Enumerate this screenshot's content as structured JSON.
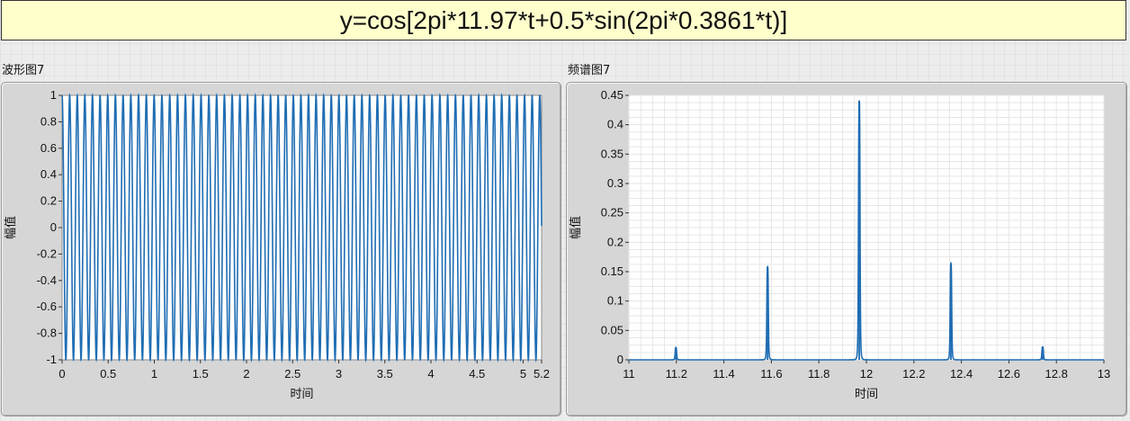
{
  "formula": "y=cos[2pi*11.97*t+0.5*sin(2pi*0.3861*t)]",
  "panels": {
    "left_title": "波形图7",
    "right_title": "频谱图7"
  },
  "colors": {
    "trace": "#1f6db3",
    "plot_bg": "#ffffff",
    "panel_bg": "#d6d6d6",
    "grid": "#e6e6e6"
  },
  "chart_data": [
    {
      "type": "line",
      "title": "波形图7",
      "xlabel": "时间",
      "ylabel": "幅值",
      "xlim": [
        0,
        5.2
      ],
      "ylim": [
        -1,
        1
      ],
      "x_ticks": [
        "0",
        "0.5",
        "1",
        "1.5",
        "2",
        "2.5",
        "3",
        "3.5",
        "4",
        "4.5",
        "5",
        "5.2"
      ],
      "x_tick_values": [
        0,
        0.5,
        1,
        1.5,
        2,
        2.5,
        3,
        3.5,
        4,
        4.5,
        5,
        5.2
      ],
      "y_ticks": [
        "1",
        "0.8",
        "0.6",
        "0.4",
        "0.2",
        "0",
        "-0.2",
        "-0.4",
        "-0.6",
        "-0.8",
        "-1"
      ],
      "y_tick_values": [
        1,
        0.8,
        0.6,
        0.4,
        0.2,
        0,
        -0.2,
        -0.4,
        -0.6,
        -0.8,
        -1
      ],
      "grid": false,
      "signal": {
        "carrier_hz": 11.97,
        "mod_index": 0.5,
        "mod_hz": 0.3861,
        "t_end": 5.2
      }
    },
    {
      "type": "line",
      "title": "频谱图7",
      "xlabel": "时间",
      "ylabel": "幅值",
      "xlim": [
        11,
        13
      ],
      "ylim": [
        0,
        0.45
      ],
      "x_ticks": [
        "11",
        "11.2",
        "11.4",
        "11.6",
        "11.8",
        "12",
        "12.2",
        "12.4",
        "12.6",
        "12.8",
        "13"
      ],
      "x_tick_values": [
        11,
        11.2,
        11.4,
        11.6,
        11.8,
        12,
        12.2,
        12.4,
        12.6,
        12.8,
        13
      ],
      "y_ticks": [
        "0.45",
        "0.4",
        "0.35",
        "0.3",
        "0.25",
        "0.2",
        "0.15",
        "0.1",
        "0.05",
        "0"
      ],
      "y_tick_values": [
        0.45,
        0.4,
        0.35,
        0.3,
        0.25,
        0.2,
        0.15,
        0.1,
        0.05,
        0
      ],
      "grid": true,
      "peaks": [
        {
          "x": 11.198,
          "y": 0.021
        },
        {
          "x": 11.584,
          "y": 0.158
        },
        {
          "x": 11.97,
          "y": 0.441
        },
        {
          "x": 12.356,
          "y": 0.164
        },
        {
          "x": 12.742,
          "y": 0.022
        }
      ]
    }
  ]
}
